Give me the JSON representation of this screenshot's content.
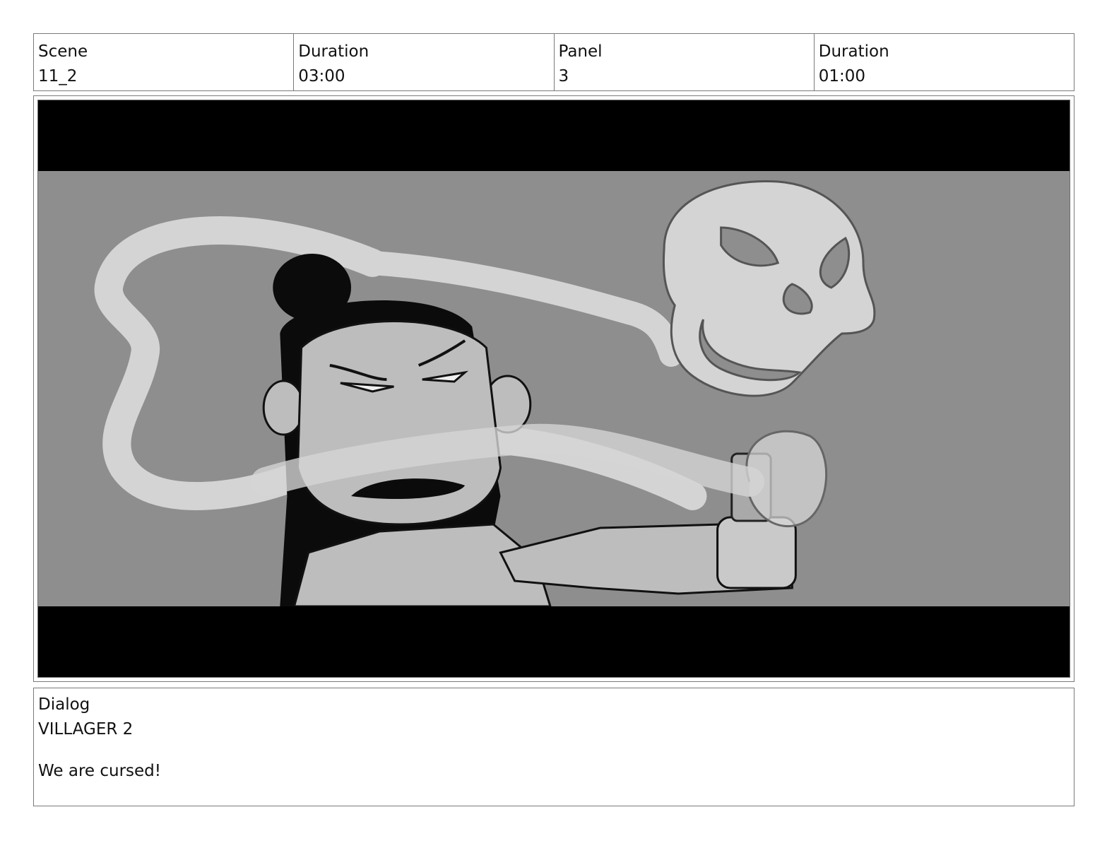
{
  "header": {
    "scene_label": "Scene",
    "scene_value": "11_2",
    "scene_duration_label": "Duration",
    "scene_duration_value": "03:00",
    "panel_label": "Panel",
    "panel_value": "3",
    "panel_duration_label": "Duration",
    "panel_duration_value": "01:00"
  },
  "panel_image": {
    "subject": "storyboard-sketch-villager-with-ghost-skull-smoke",
    "colors": {
      "background": "#8e8e8e",
      "letterbox": "#000000",
      "smoke": "#d4d4d4",
      "skin": "#bdbdbd"
    }
  },
  "dialog": {
    "label": "Dialog",
    "character": "VILLAGER 2",
    "line": "We are cursed!"
  }
}
